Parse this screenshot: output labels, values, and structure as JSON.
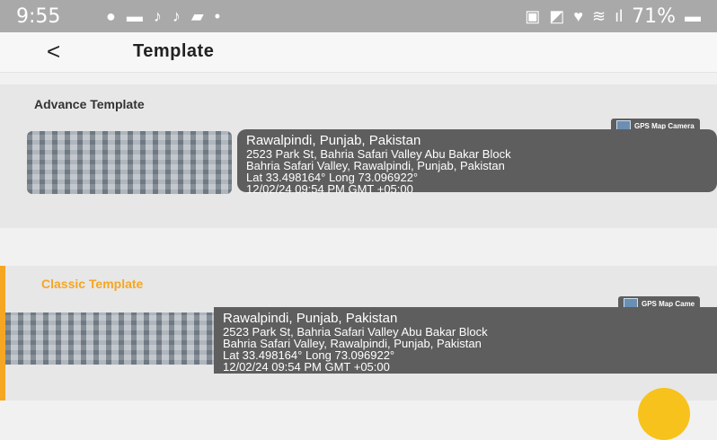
{
  "status": {
    "time": "9:55",
    "battery": "71%"
  },
  "appbar": {
    "back": "<",
    "title": "Template"
  },
  "templates": [
    {
      "name": "Advance Template",
      "badge": "GPS Map Camera",
      "line1": "Rawalpindi, Punjab, Pakistan",
      "line2": "2523 Park St, Bahria Safari Valley Abu Bakar Block",
      "line3": "Bahria Safari Valley, Rawalpindi, Punjab, Pakistan",
      "line4": "Lat 33.498164° Long 73.096922°",
      "line5": "12/02/24 09:54 PM GMT +05:00"
    },
    {
      "name": "Classic Template",
      "badge": "GPS Map Came",
      "line1": "Rawalpindi, Punjab, Pakistan",
      "line2": "2523 Park St, Bahria Safari Valley Abu Bakar Block",
      "line3": "Bahria Safari Valley, Rawalpindi, Punjab, Pakistan",
      "line4": "Lat 33.498164° Long 73.096922°",
      "line5": "12/02/24 09:54 PM GMT +05:00"
    }
  ],
  "colors": {
    "accent": "#f5a623",
    "fab": "#f7c21b",
    "card": "#5e5e5e"
  }
}
